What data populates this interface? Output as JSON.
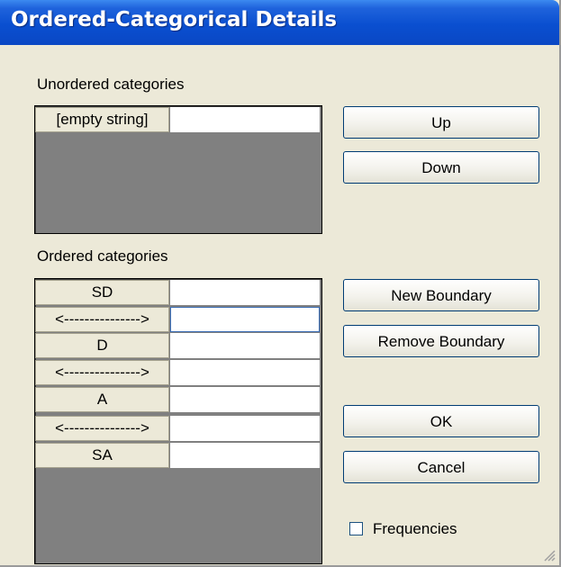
{
  "window": {
    "title": "Ordered-Categorical Details"
  },
  "unordered": {
    "label": "Unordered categories",
    "rows": [
      {
        "name": "[empty string]",
        "value": ""
      }
    ]
  },
  "ordered": {
    "label": "Ordered categories",
    "rows": [
      {
        "name": "SD",
        "value": ""
      },
      {
        "name": "<--------------->",
        "value": ""
      },
      {
        "name": "D",
        "value": ""
      },
      {
        "name": "<--------------->",
        "value": ""
      },
      {
        "name": "A",
        "value": ""
      },
      {
        "name": "<--------------->",
        "value": ""
      },
      {
        "name": "SA",
        "value": ""
      }
    ]
  },
  "buttons": {
    "up": "Up",
    "down": "Down",
    "new_boundary": "New Boundary",
    "remove_boundary": "Remove Boundary",
    "ok": "OK",
    "cancel": "Cancel"
  },
  "frequencies": {
    "label": "Frequencies",
    "checked": false
  }
}
